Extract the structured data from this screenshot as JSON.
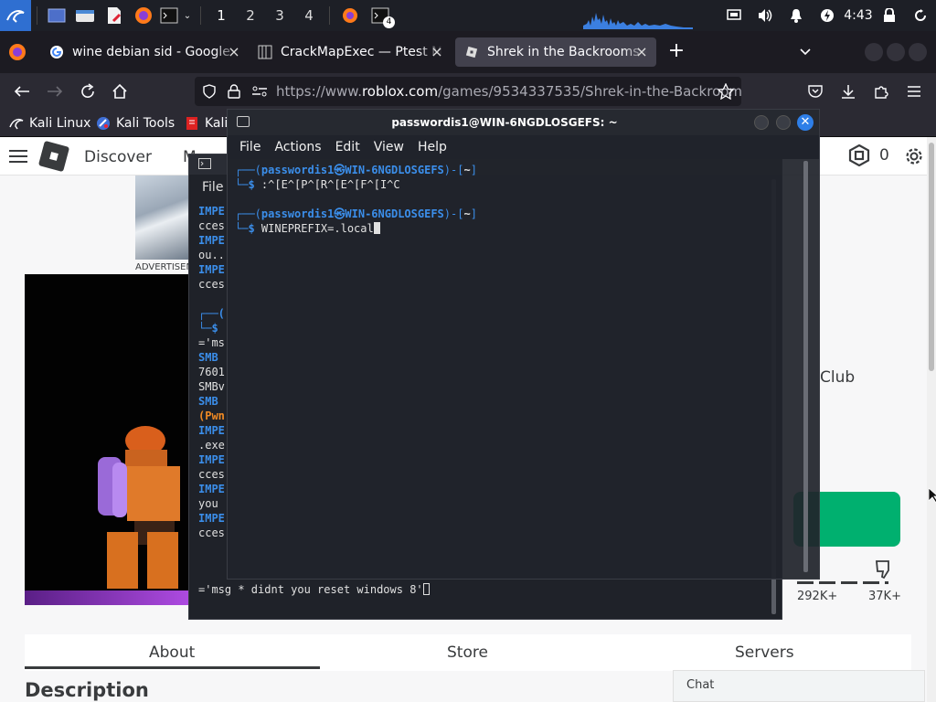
{
  "panel": {
    "workspaces": [
      "1",
      "2",
      "3",
      "4"
    ],
    "terminal_badge": "4",
    "clock": "4:43"
  },
  "browser": {
    "tabs": [
      {
        "title": "wine debian sid - Google"
      },
      {
        "title": "CrackMapExec — Ptest M"
      },
      {
        "title": "Shrek in the Backrooms -"
      }
    ],
    "url_prefix": "https://www.",
    "url_domain": "roblox.com",
    "url_path": "/games/9534337535/Shrek-in-the-Backroom",
    "bookmarks": [
      "Kali Linux",
      "Kali Tools",
      "Kali"
    ]
  },
  "roblox": {
    "nav_discover": "Discover",
    "nav_m": "M",
    "robux_count": "0",
    "advertisement": "ADVERTISEMENT",
    "right_text": "Club",
    "upvotes": "292K+",
    "downvotes": "37K+",
    "tabs": [
      "About",
      "Store",
      "Servers"
    ],
    "description_heading": "Description",
    "chat_label": "Chat"
  },
  "back_terminal": {
    "menu_file": "File",
    "lines": [
      "IMPE",
      "cces",
      "IMPE",
      "ou..",
      "IMPE",
      "cces",
      "",
      "",
      "='ms",
      "SMB",
      "7601",
      "SMBv",
      "SMB",
      "(Pwn",
      "IMPE",
      ".exe",
      "IMPE",
      "cces",
      "IMPE",
      " you",
      "IMPE",
      "cces"
    ],
    "last_line": "='msg * didnt you reset windows 8'"
  },
  "front_terminal": {
    "title": "passwordis1@WIN-6NGDLOSGEFS: ~",
    "menu": [
      "File",
      "Actions",
      "Edit",
      "View",
      "Help"
    ],
    "prompt_user": "passwordis1",
    "prompt_at": "㉿",
    "prompt_host": "WIN-6NGDLOSGEFS",
    "prompt_dir": "~",
    "commands": [
      ":^[E^[P^[R^[E^[F^[I^C",
      "WINEPREFIX=.local"
    ]
  }
}
